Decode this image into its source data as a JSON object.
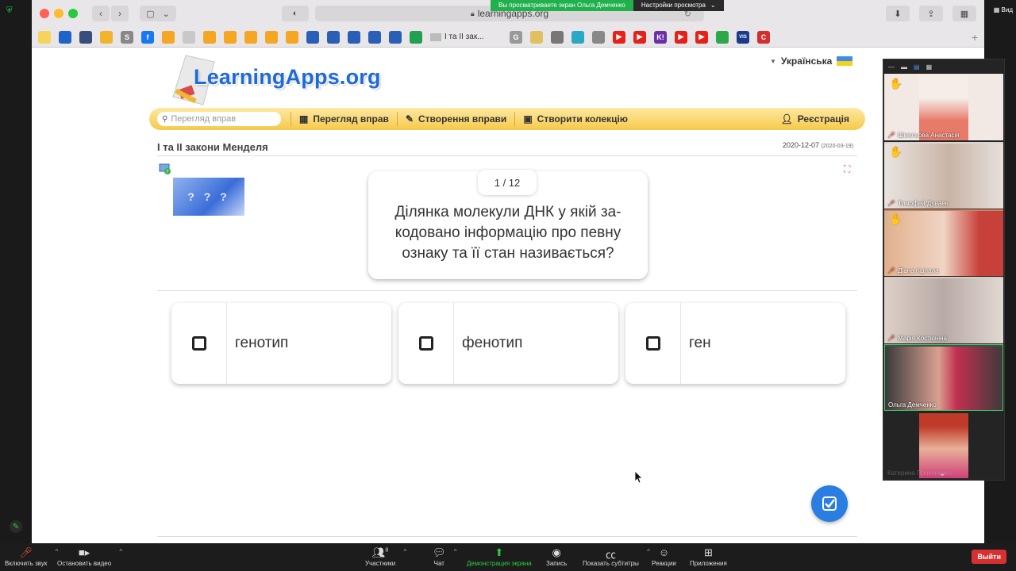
{
  "zoom_banner": {
    "message": "Вы просматриваете экран Ольга  Демченко",
    "view_options": "Настройки просмотра"
  },
  "right_strip": {
    "view_label": "Вид"
  },
  "browser": {
    "url": "learningapps.org",
    "bookmarks_tab_label": "І та ІІ зак...",
    "bookmark_letters": [
      "S",
      "G",
      "K!",
      "VIS"
    ]
  },
  "site": {
    "logo": "LearningApps.org",
    "language": "Українська",
    "nav": {
      "search_placeholder": "Перегляд вправ",
      "browse": "Перегляд вправ",
      "create": "Створення вправи",
      "collection": "Створити колекцію",
      "register": "Реєстрація"
    }
  },
  "app": {
    "title": "І та ІІ закони Менделя",
    "date": "2020-12-07",
    "date_created": "(2020-03-19)",
    "counter": "1 / 12",
    "question": "Ділянка молекули ДНК у якій за-кодовано інформацію про певну ознаку та її стан називається?",
    "answers": [
      {
        "label": "генотип"
      },
      {
        "label": "фенотип"
      },
      {
        "label": "ген"
      }
    ],
    "check_icon": "check-badge-icon"
  },
  "participants": [
    {
      "name": "Шмельова Анастасія",
      "hand_raised": true,
      "muted": true
    },
    {
      "name": "Тимофей Дунаев",
      "hand_raised": true,
      "muted": true
    },
    {
      "name": "Діана підпала",
      "hand_raised": true,
      "muted": true
    },
    {
      "name": "Марія Костюніна",
      "hand_raised": false,
      "muted": true
    },
    {
      "name": "Ольга  Демченко",
      "hand_raised": false,
      "muted": false,
      "active": true
    },
    {
      "name": "Катерина Прокопенко",
      "hand_raised": false,
      "muted": true
    }
  ],
  "zoom_toolbar": {
    "unmute": "Включить звук",
    "stop_video": "Остановить видео",
    "participants": "Участники",
    "participants_count": "8",
    "chat": "Чат",
    "share_screen": "Демонстрация экрана",
    "record": "Запись",
    "captions": "Показать субтитры",
    "reactions": "Реакции",
    "apps": "Приложения",
    "leave": "Выйти"
  },
  "colors": {
    "accent_blue": "#2a7de1",
    "zoom_green": "#2ecc40",
    "leave_red": "#d63031",
    "nav_gold": "#f7c94b"
  }
}
